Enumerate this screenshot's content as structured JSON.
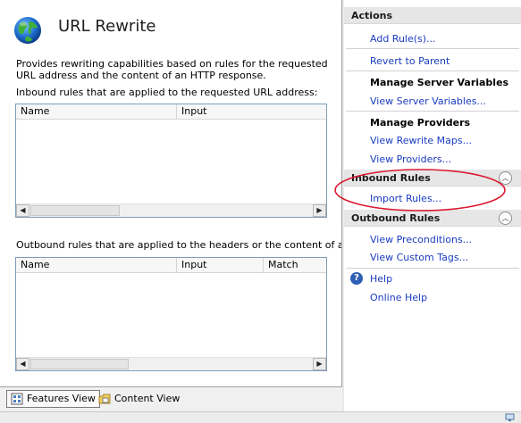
{
  "main": {
    "title": "URL Rewrite",
    "description": "Provides rewriting capabilities based on rules for the requested URL address and the content of an HTTP response.",
    "inbound_caption": "Inbound rules that are applied to the requested URL address:",
    "inbound_columns": [
      "Name",
      "Input"
    ],
    "outbound_caption": "Outbound rules that are applied to the headers or the content of an HTTP",
    "outbound_columns": [
      "Name",
      "Input",
      "Match"
    ]
  },
  "bottom_bar": {
    "features_view": "Features View",
    "content_view": "Content View"
  },
  "actions": {
    "header": "Actions",
    "add_rules": "Add Rule(s)...",
    "revert": "Revert to Parent",
    "server_vars_head": "Manage Server Variables",
    "view_server_vars": "View Server Variables...",
    "providers_head": "Manage Providers",
    "view_rewrite_maps": "View Rewrite Maps...",
    "view_providers": "View Providers...",
    "inbound_rules": "Inbound Rules",
    "import_rules": "Import Rules...",
    "outbound_rules": "Outbound Rules",
    "view_preconditions": "View Preconditions...",
    "view_custom_tags": "View Custom Tags...",
    "help": "Help",
    "online_help": "Online Help"
  },
  "colors": {
    "link": "#1a3cc0",
    "highlight": "#d9182e"
  }
}
